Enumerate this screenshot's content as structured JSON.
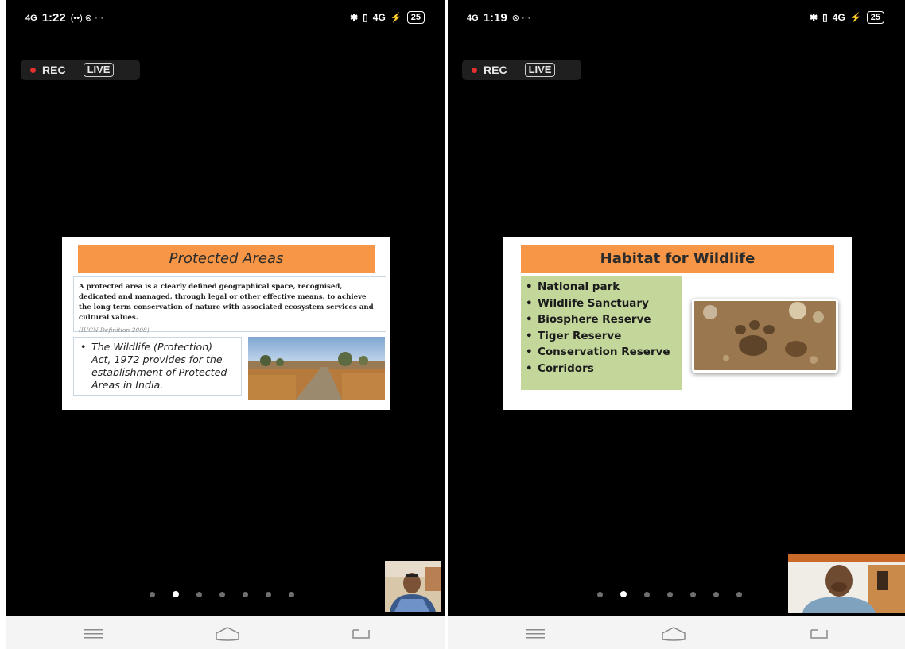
{
  "left_screen": {
    "status": {
      "network": "4G",
      "time": "1:22",
      "extra": "(••) ⊗ ···",
      "battery": "25"
    },
    "recording": {
      "rec_label": "REC",
      "live_label": "LIVE"
    },
    "slide": {
      "title": "Protected Areas",
      "definition": "A protected area is a clearly defined geographical space, recognised, dedicated and managed, through legal or other effective means, to achieve the long term conservation of nature with associated ecosystem services and cultural values.",
      "source": "(IUCN Definition 2008)",
      "bullet": "The Wildlife (Protection) Act, 1972 provides for the establishment of Protected Areas in India."
    },
    "pager": {
      "count": 7,
      "active_index": 1
    }
  },
  "right_screen": {
    "status": {
      "network": "4G",
      "time": "1:19",
      "extra": "⊗ ···",
      "battery": "25"
    },
    "recording": {
      "rec_label": "REC",
      "live_label": "LIVE"
    },
    "slide": {
      "title": "Habitat for Wildlife",
      "items": [
        "National park",
        "Wildlife Sanctuary",
        "Biosphere Reserve",
        "Tiger Reserve",
        "Conservation Reserve",
        "Corridors"
      ]
    },
    "pager": {
      "count": 7,
      "active_index": 1
    }
  },
  "colors": {
    "title_bar": "#f79646",
    "list_bg": "#c4d79b",
    "rec_dot": "#e53030"
  },
  "icons": [
    "bluetooth-icon",
    "vibrate-icon",
    "signal-icon",
    "charging-icon",
    "menu-icon",
    "home-icon",
    "back-icon"
  ]
}
